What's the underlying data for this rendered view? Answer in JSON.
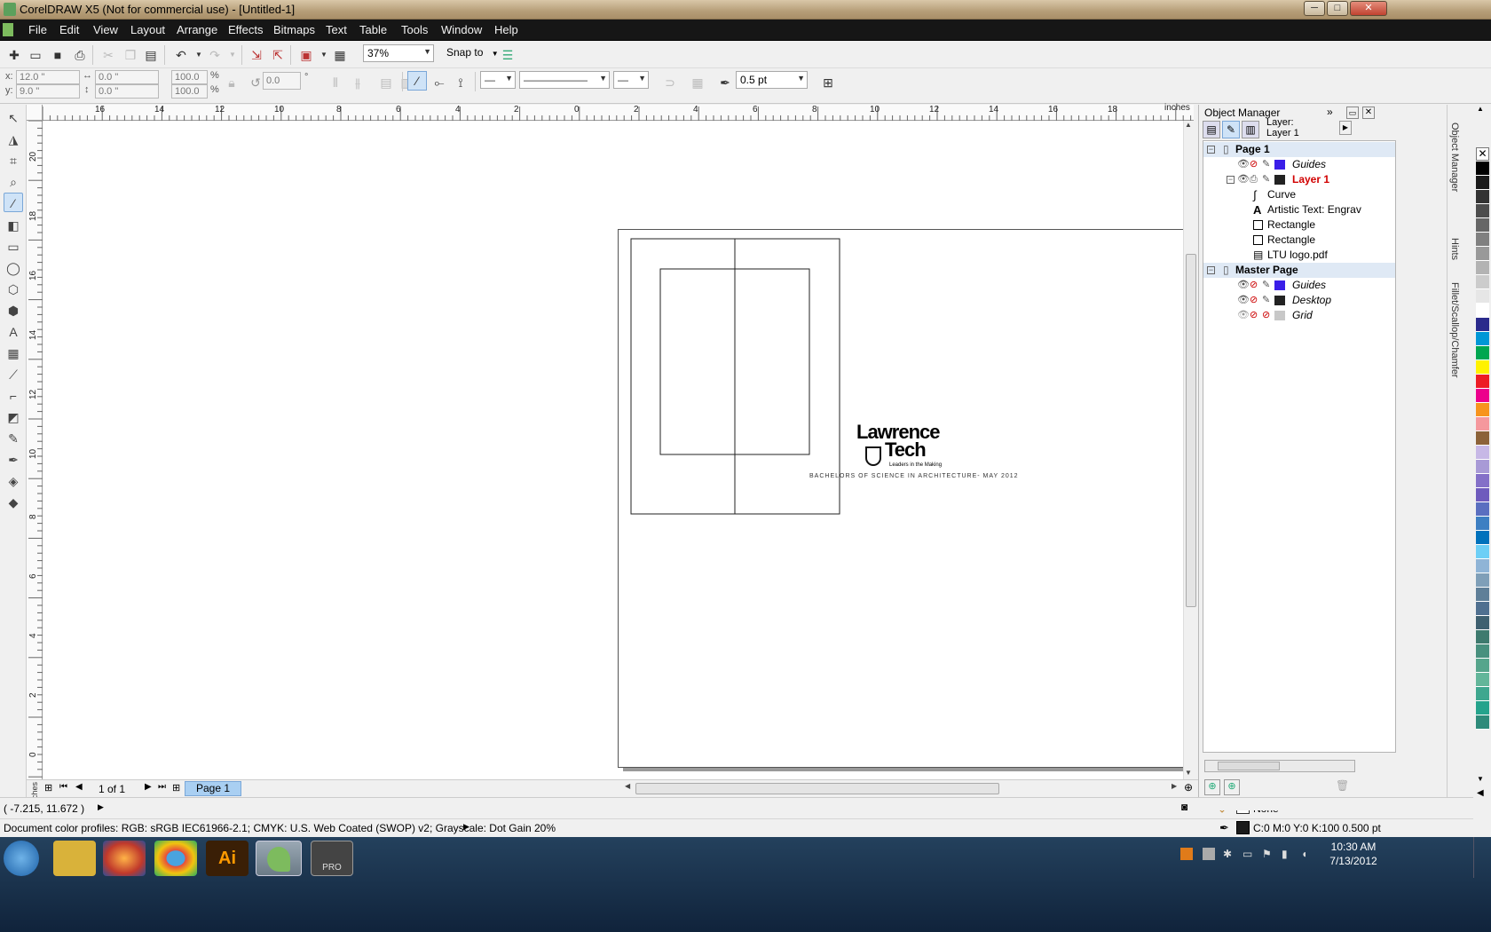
{
  "window": {
    "title": "CorelDRAW X5 (Not for commercial use) - [Untitled-1]",
    "minimize": "─",
    "maximize": "□",
    "close": "✕"
  },
  "menu": [
    "File",
    "Edit",
    "View",
    "Layout",
    "Arrange",
    "Effects",
    "Bitmaps",
    "Text",
    "Table",
    "Tools",
    "Window",
    "Help"
  ],
  "standard_toolbar": {
    "zoom": "37%",
    "snap_to": "Snap to"
  },
  "property_bar": {
    "x": "12.0 \"",
    "y": "9.0 \"",
    "width": "0.0 \"",
    "height": "0.0 \"",
    "scale_x": "100.0",
    "scale_y": "100.0",
    "pct": "%",
    "rotation": "0.0",
    "degree": "°",
    "outline_width": "0.5 pt"
  },
  "ruler": {
    "unit": "inches",
    "h_ticks": [
      "16",
      "14",
      "12",
      "10",
      "8",
      "6",
      "4",
      "2",
      "0",
      "2",
      "4",
      "6",
      "8",
      "10",
      "12",
      "14",
      "16",
      "18"
    ],
    "v_ticks": [
      "20",
      "18",
      "16",
      "14",
      "12",
      "10",
      "8",
      "6",
      "4",
      "2",
      "0"
    ]
  },
  "canvas": {
    "logo_line1": "Lawrence",
    "logo_line2": "Tech",
    "logo_tagline": "Leaders in the Making",
    "caption": "BACHELORS OF SCIENCE IN ARCHITECTURE- MAY 2012"
  },
  "doc_nav": {
    "page_count": "1 of 1",
    "page_tab": "Page 1"
  },
  "status": {
    "coords": "( -7.215, 11.672 )",
    "profiles": "Document color profiles: RGB: sRGB IEC61966-2.1; CMYK: U.S. Web Coated (SWOP) v2; Grayscale: Dot Gain 20%",
    "fill": "None",
    "outline": "C:0 M:0 Y:0 K:100  0.500 pt"
  },
  "object_manager": {
    "title": "Object Manager",
    "layer_label": "Layer:",
    "layer_value": "Layer 1",
    "rows": [
      {
        "label": "Page 1",
        "kind": "page"
      },
      {
        "label": "Guides",
        "kind": "layer",
        "color": "#3a1ee8"
      },
      {
        "label": "Layer 1",
        "kind": "active",
        "color": "#222222"
      },
      {
        "label": "Curve",
        "kind": "obj",
        "icon": "curve-icon"
      },
      {
        "label": "Artistic Text: Engrav",
        "kind": "obj",
        "icon": "text-icon"
      },
      {
        "label": "Rectangle",
        "kind": "obj",
        "icon": "rect-icon"
      },
      {
        "label": "Rectangle",
        "kind": "obj",
        "icon": "rect-icon"
      },
      {
        "label": "LTU logo.pdf",
        "kind": "obj",
        "icon": "pdf-icon"
      },
      {
        "label": "Master Page",
        "kind": "page"
      },
      {
        "label": "Guides",
        "kind": "layer",
        "color": "#3a1ee8"
      },
      {
        "label": "Desktop",
        "kind": "layer",
        "color": "#222222"
      },
      {
        "label": "Grid",
        "kind": "layer",
        "color": "#c8c8c8"
      }
    ]
  },
  "side_tabs": [
    "Object Manager",
    "Hints",
    "Fillet/Scallop/Chamfer"
  ],
  "taskbar": {
    "time": "10:30 AM",
    "date": "7/13/2012",
    "apps": [
      "start",
      "explorer",
      "firefox",
      "chrome",
      "illustrator",
      "coreldraw",
      "vectorworks"
    ]
  },
  "palette": [
    "#000000",
    "#1a1a1a",
    "#333333",
    "#4d4d4d",
    "#666666",
    "#808080",
    "#999999",
    "#b3b3b3",
    "#cccccc",
    "#e6e6e6",
    "#ffffff",
    "#2a2a8c",
    "#0097d6",
    "#00a650",
    "#fff200",
    "#ed1c24",
    "#ec008c",
    "#f7941d",
    "#f5989d",
    "#8c6239",
    "#c7b8e6",
    "#a89ad6",
    "#8470c8",
    "#6f5bbd",
    "#5a6fc0",
    "#3d7fc2",
    "#0072bc",
    "#6dcff6",
    "#8fb4d6",
    "#7f9fb8",
    "#5f7f98",
    "#507090",
    "#3f6070",
    "#3e7a6e",
    "#48907e",
    "#56a58c",
    "#63b69a",
    "#3fa78f",
    "#24a38c",
    "#2e8b7a"
  ]
}
